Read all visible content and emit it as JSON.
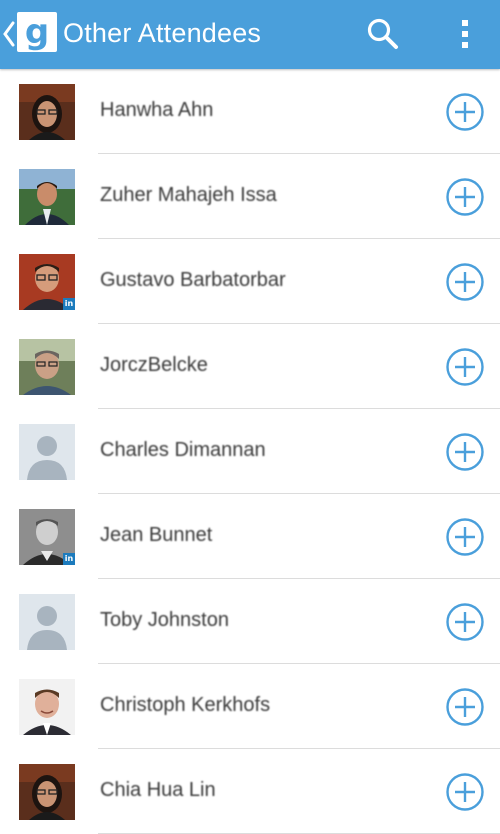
{
  "appbar": {
    "logo_letter": "g",
    "title": "Other Attendees"
  },
  "colors": {
    "appbar": "#4a9fdb",
    "add_button": "#4a9fdb",
    "divider": "#dcdcdc"
  },
  "attendees": [
    {
      "name": "Hanwha Ahn",
      "avatar": "photo-woman-glasses"
    },
    {
      "name": "Zuher Mahajeh Issa",
      "avatar": "photo-man-suit"
    },
    {
      "name": "Gustavo Barbatorbar",
      "avatar": "photo-man-glasses",
      "badge": "in"
    },
    {
      "name": "JorczBelcke",
      "avatar": "photo-man-outdoor"
    },
    {
      "name": "Charles Dimannan",
      "avatar": "placeholder-person-icon"
    },
    {
      "name": "Jean Bunnet",
      "avatar": "photo-man-grey",
      "badge": "in"
    },
    {
      "name": "Toby Johnston",
      "avatar": "placeholder-person-icon"
    },
    {
      "name": "Christoph Kerkhofs",
      "avatar": "photo-man-smiling"
    },
    {
      "name": "Chia Hua Lin",
      "avatar": "photo-woman-glasses"
    }
  ]
}
